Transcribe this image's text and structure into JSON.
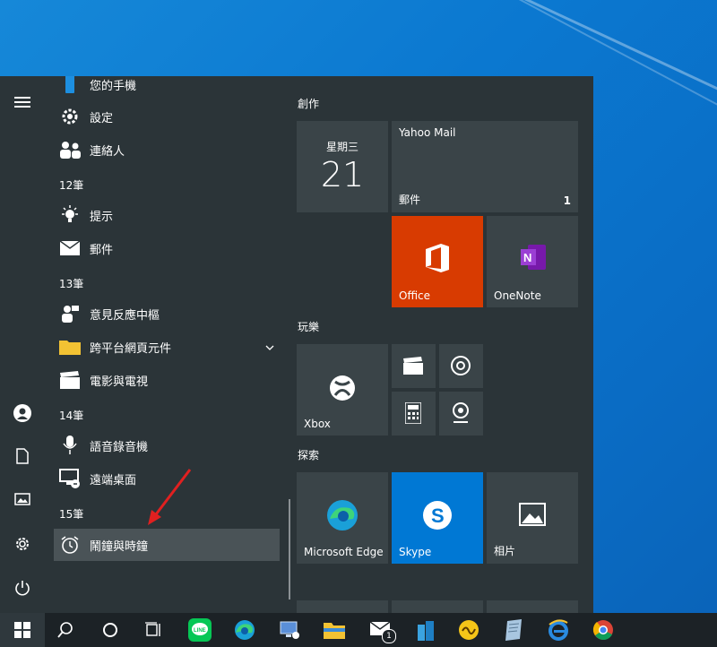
{
  "start_menu": {
    "apps": [
      {
        "label": "您的手機"
      },
      {
        "label": "設定"
      },
      {
        "label": "連絡人"
      },
      {
        "header": "12筆"
      },
      {
        "label": "提示"
      },
      {
        "label": "郵件"
      },
      {
        "header": "13筆"
      },
      {
        "label": "意見反應中樞"
      },
      {
        "label": "跨平台網頁元件"
      },
      {
        "label": "電影與電視"
      },
      {
        "header": "14筆"
      },
      {
        "label": "語音錄音機"
      },
      {
        "label": "遠端桌面"
      },
      {
        "header": "15筆"
      },
      {
        "label": "鬧鐘與時鐘"
      }
    ],
    "groups": {
      "create": "創作",
      "play": "玩樂",
      "explore": "探索"
    },
    "tiles": {
      "calendar": {
        "day": "星期三",
        "date": "21"
      },
      "mail": {
        "title": "Yahoo Mail",
        "label": "郵件",
        "badge": "1"
      },
      "office": {
        "label": "Office"
      },
      "onenote": {
        "label": "OneNote"
      },
      "xbox": {
        "label": "Xbox"
      },
      "edge": {
        "label": "Microsoft Edge"
      },
      "skype": {
        "label": "Skype"
      },
      "photos": {
        "label": "相片"
      }
    }
  },
  "taskbar": {
    "mail_badge": "1"
  },
  "colors": {
    "office": "#d83b01",
    "skype": "#0078d4",
    "tile": "#3a4448",
    "accent": "#e02020"
  }
}
